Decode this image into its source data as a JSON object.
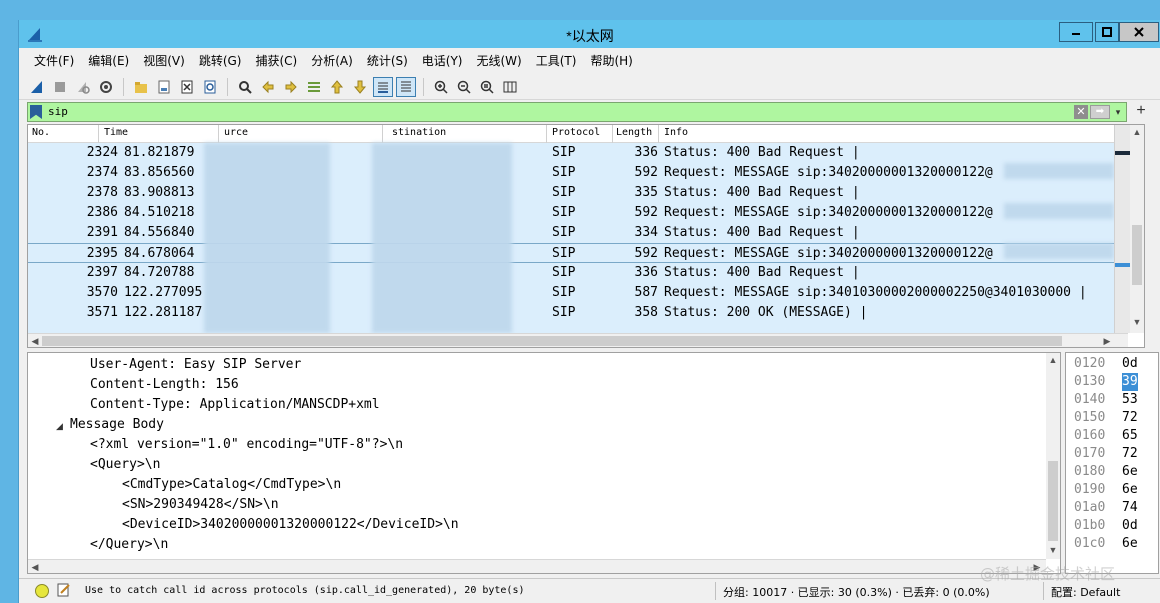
{
  "window": {
    "title": "*以太网"
  },
  "menu": [
    "文件(F)",
    "编辑(E)",
    "视图(V)",
    "跳转(G)",
    "捕获(C)",
    "分析(A)",
    "统计(S)",
    "电话(Y)",
    "无线(W)",
    "工具(T)",
    "帮助(H)"
  ],
  "toolbar_icons": [
    "shark-fin-start-icon",
    "stop-icon",
    "restart-icon",
    "options-gear-icon",
    "open-folder-icon",
    "save-file-icon",
    "close-file-icon",
    "reload-icon",
    "find-icon",
    "back-arrow-icon",
    "forward-arrow-icon",
    "goto-packet-icon",
    "first-packet-icon",
    "last-packet-icon",
    "autoscroll-icon",
    "colorize-icon",
    "zoom-in-icon",
    "zoom-out-icon",
    "zoom-normal-icon",
    "resize-columns-icon"
  ],
  "filter": {
    "value": "sip",
    "color": "#aff6a0"
  },
  "packet_list": {
    "columns": {
      "no": "No.",
      "time": "Time",
      "source": "urce",
      "destination": "stination",
      "protocol": "Protocol",
      "length": "Length",
      "info": "Info"
    },
    "rows": [
      {
        "no": "2324",
        "time": "81.821879",
        "source": "",
        "destination": "",
        "protocol": "SIP",
        "length": "336",
        "info": "Status: 400 Bad Request |"
      },
      {
        "no": "2374",
        "time": "83.856560",
        "source": "",
        "destination": "",
        "protocol": "SIP",
        "length": "592",
        "info": "Request: MESSAGE sip:34020000001320000122@"
      },
      {
        "no": "2378",
        "time": "83.908813",
        "source": "",
        "destination": "",
        "protocol": "SIP",
        "length": "335",
        "info": "Status: 400 Bad Request |"
      },
      {
        "no": "2386",
        "time": "84.510218",
        "source": "",
        "destination": "",
        "protocol": "SIP",
        "length": "592",
        "info": "Request: MESSAGE sip:34020000001320000122@"
      },
      {
        "no": "2391",
        "time": "84.556840",
        "source": "",
        "destination": "",
        "protocol": "SIP",
        "length": "334",
        "info": "Status: 400 Bad Request |"
      },
      {
        "no": "2395",
        "time": "84.678064",
        "source": "",
        "destination": "",
        "protocol": "SIP",
        "length": "592",
        "info": "Request: MESSAGE sip:34020000001320000122@"
      },
      {
        "no": "2397",
        "time": "84.720788",
        "source": "",
        "destination": "",
        "protocol": "SIP",
        "length": "336",
        "info": "Status: 400 Bad Request |"
      },
      {
        "no": "3570",
        "time": "122.277095",
        "source": "",
        "destination": "",
        "protocol": "SIP",
        "length": "587",
        "info": "Request: MESSAGE sip:34010300002000002250@3401030000 |"
      },
      {
        "no": "3571",
        "time": "122.281187",
        "source": "",
        "destination": "",
        "protocol": "SIP",
        "length": "358",
        "info": "Status: 200 OK (MESSAGE) |"
      }
    ],
    "selected_index": 5
  },
  "details": [
    {
      "text": "User-Agent: Easy SIP Server",
      "indent": 1
    },
    {
      "text": "Content-Length: 156",
      "indent": 1
    },
    {
      "text": "Content-Type: Application/MANSCDP+xml",
      "indent": 1
    },
    {
      "text": "Message Body",
      "indent": 0,
      "expanded": true
    },
    {
      "text": "<?xml version=\"1.0\" encoding=\"UTF-8\"?>\\n",
      "indent": 2
    },
    {
      "text": "<Query>\\n",
      "indent": 2
    },
    {
      "text": "<CmdType>Catalog</CmdType>\\n",
      "indent": 3
    },
    {
      "text": "<SN>290349428</SN>\\n",
      "indent": 3
    },
    {
      "text": "<DeviceID>34020000001320000122</DeviceID>\\n",
      "indent": 3
    },
    {
      "text": "</Query>\\n",
      "indent": 2
    }
  ],
  "bytes": [
    {
      "offset": "0120",
      "value": "0d"
    },
    {
      "offset": "0130",
      "value": "39",
      "highlight": true
    },
    {
      "offset": "0140",
      "value": "53"
    },
    {
      "offset": "0150",
      "value": "72"
    },
    {
      "offset": "0160",
      "value": "65"
    },
    {
      "offset": "0170",
      "value": "72"
    },
    {
      "offset": "0180",
      "value": "6e"
    },
    {
      "offset": "0190",
      "value": "6e"
    },
    {
      "offset": "01a0",
      "value": "74"
    },
    {
      "offset": "01b0",
      "value": "0d"
    },
    {
      "offset": "01c0",
      "value": "6e"
    }
  ],
  "status": {
    "message": "Use to catch call id across protocols (sip.call_id_generated), 20 byte(s)",
    "stats": "分组: 10017 · 已显示: 30 (0.3%) · 已丢弃: 0 (0.0%)",
    "profile": "配置: Default"
  },
  "watermark": "@稀土掘金技术社区"
}
